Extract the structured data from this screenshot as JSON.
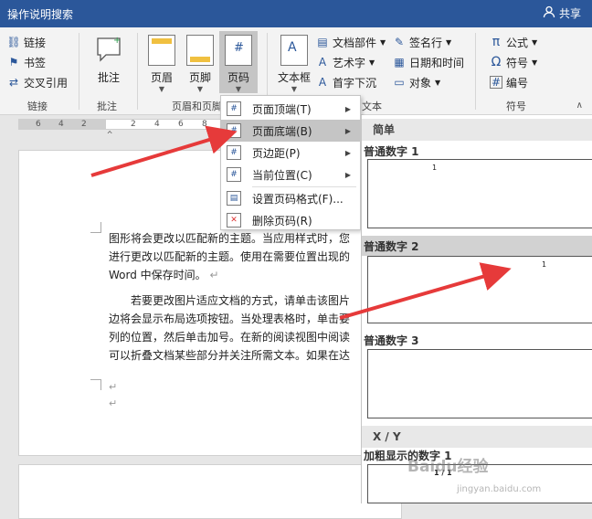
{
  "topbar": {
    "search_label": "操作说明搜索",
    "share_label": "共享"
  },
  "ribbon": {
    "links": {
      "items": [
        "链接",
        "书签",
        "交叉引用"
      ],
      "group": "链接"
    },
    "comment": {
      "label": "批注",
      "group": "批注"
    },
    "header_footer": {
      "header": "页眉",
      "footer": "页脚",
      "page_number": "页码",
      "group": "页眉和页脚"
    },
    "text": {
      "textbox": "文本框",
      "doc_parts": "文档部件",
      "wordart": "艺术字",
      "dropcap": "首字下沉",
      "signature": "签名行",
      "datetime": "日期和时间",
      "object": "对象",
      "group": "文本"
    },
    "symbols": {
      "equation": "公式",
      "symbol": "符号",
      "number": "编号",
      "group": "符号"
    }
  },
  "ruler": {
    "ticks": [
      "6",
      "4",
      "2",
      "2",
      "4",
      "6",
      "8"
    ]
  },
  "document": {
    "para1": [
      "图形将会更改以匹配新的主题。当应用样式时，您",
      "进行更改以匹配新的主题。使用在需要位置出现的",
      "Word  中保存时间。"
    ],
    "para2": [
      "若要更改图片适应文档的方式，请单击该图片",
      "边将会显示布局选项按钮。当处理表格时，单击要",
      "列的位置，然后单击加号。在新的阅读视图中阅读",
      "可以折叠文档某些部分并关注所需文本。如果在达"
    ],
    "return_mark": "↵"
  },
  "menu": {
    "items": [
      {
        "label": "页面顶端(T)",
        "has_submenu": true
      },
      {
        "label": "页面底端(B)",
        "has_submenu": true
      },
      {
        "label": "页边距(P)",
        "has_submenu": true
      },
      {
        "label": "当前位置(C)",
        "has_submenu": true
      },
      {
        "label": "设置页码格式(F)...",
        "has_submenu": false
      },
      {
        "label": "删除页码(R)",
        "has_submenu": false
      }
    ]
  },
  "gallery": {
    "section_simple": "简单",
    "items": [
      {
        "title": "普通数字 1",
        "number": "1"
      },
      {
        "title": "普通数字 2",
        "number": "1"
      },
      {
        "title": "普通数字 3",
        "number": ""
      }
    ],
    "section_xy": "X / Y",
    "bold_item": {
      "title": "加粗显示的数字 1",
      "number": "1 / 1"
    }
  },
  "watermark": {
    "brand": "Baidu经验",
    "url": "jingyan.baidu.com"
  },
  "colors": {
    "titlebar": "#2b579a",
    "highlight": "#c5c5c5",
    "arrow": "#e63a3a"
  }
}
